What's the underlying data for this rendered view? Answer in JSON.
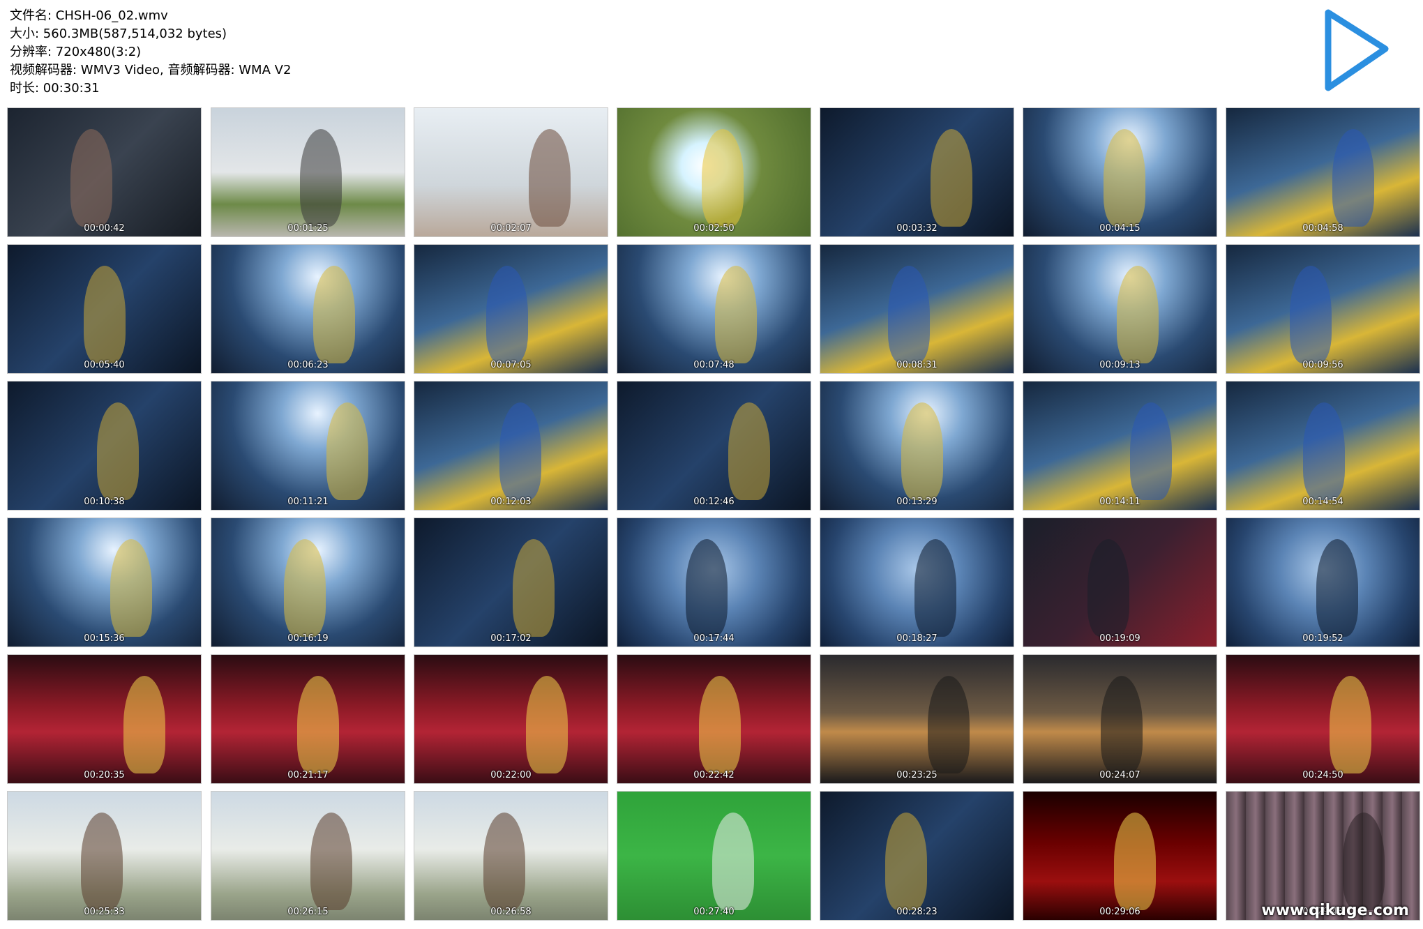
{
  "info": {
    "filename": "文件名: CHSH-06_02.wmv",
    "size": "大小: 560.3MB(587,514,032 bytes)",
    "resolution": "分辨率: 720x480(3:2)",
    "codecs": "视频解码器: WMV3 Video, 音频解码器: WMA V2",
    "duration": "时长: 00:30:31"
  },
  "play_icon": "play-triangle-icon",
  "accent_color": "#2b8fe0",
  "thumbnails": [
    {
      "time": "00:00:42",
      "scene": "dark-room"
    },
    {
      "time": "00:01:25",
      "scene": "tower-road"
    },
    {
      "time": "00:02:07",
      "scene": "two-women-sky"
    },
    {
      "time": "00:02:50",
      "scene": "grass-flash"
    },
    {
      "time": "00:03:32",
      "scene": "dark-blue"
    },
    {
      "time": "00:04:15",
      "scene": "blue-light"
    },
    {
      "time": "00:04:58",
      "scene": "blue-costume"
    },
    {
      "time": "00:05:40",
      "scene": "dark-blue"
    },
    {
      "time": "00:06:23",
      "scene": "blue-light"
    },
    {
      "time": "00:07:05",
      "scene": "blue-costume"
    },
    {
      "time": "00:07:48",
      "scene": "blue-light"
    },
    {
      "time": "00:08:31",
      "scene": "blue-costume"
    },
    {
      "time": "00:09:13",
      "scene": "blue-light"
    },
    {
      "time": "00:09:56",
      "scene": "blue-costume"
    },
    {
      "time": "00:10:38",
      "scene": "dark-blue"
    },
    {
      "time": "00:11:21",
      "scene": "blue-light"
    },
    {
      "time": "00:12:03",
      "scene": "blue-costume"
    },
    {
      "time": "00:12:46",
      "scene": "dark-blue"
    },
    {
      "time": "00:13:29",
      "scene": "blue-light"
    },
    {
      "time": "00:14:11",
      "scene": "blue-costume"
    },
    {
      "time": "00:14:54",
      "scene": "blue-costume"
    },
    {
      "time": "00:15:36",
      "scene": "blue-light"
    },
    {
      "time": "00:16:19",
      "scene": "blue-light"
    },
    {
      "time": "00:17:02",
      "scene": "dark-blue"
    },
    {
      "time": "00:17:44",
      "scene": "blue-fog"
    },
    {
      "time": "00:18:27",
      "scene": "blue-fog"
    },
    {
      "time": "00:19:09",
      "scene": "dark-red"
    },
    {
      "time": "00:19:52",
      "scene": "blue-fog"
    },
    {
      "time": "00:20:35",
      "scene": "red-curtain"
    },
    {
      "time": "00:21:17",
      "scene": "red-curtain"
    },
    {
      "time": "00:22:00",
      "scene": "red-curtain"
    },
    {
      "time": "00:22:42",
      "scene": "red-curtain"
    },
    {
      "time": "00:23:25",
      "scene": "sunset"
    },
    {
      "time": "00:24:07",
      "scene": "sunset"
    },
    {
      "time": "00:24:50",
      "scene": "red-curtain"
    },
    {
      "time": "00:25:33",
      "scene": "outdoor-bright"
    },
    {
      "time": "00:26:15",
      "scene": "outdoor-bright"
    },
    {
      "time": "00:26:58",
      "scene": "outdoor-bright"
    },
    {
      "time": "00:27:40",
      "scene": "green-screen"
    },
    {
      "time": "00:28:23",
      "scene": "dark-blue"
    },
    {
      "time": "00:29:06",
      "scene": "ad-red"
    },
    {
      "time": "00:29:48",
      "scene": "shelves"
    }
  ],
  "watermark": "www.qikuge.com"
}
